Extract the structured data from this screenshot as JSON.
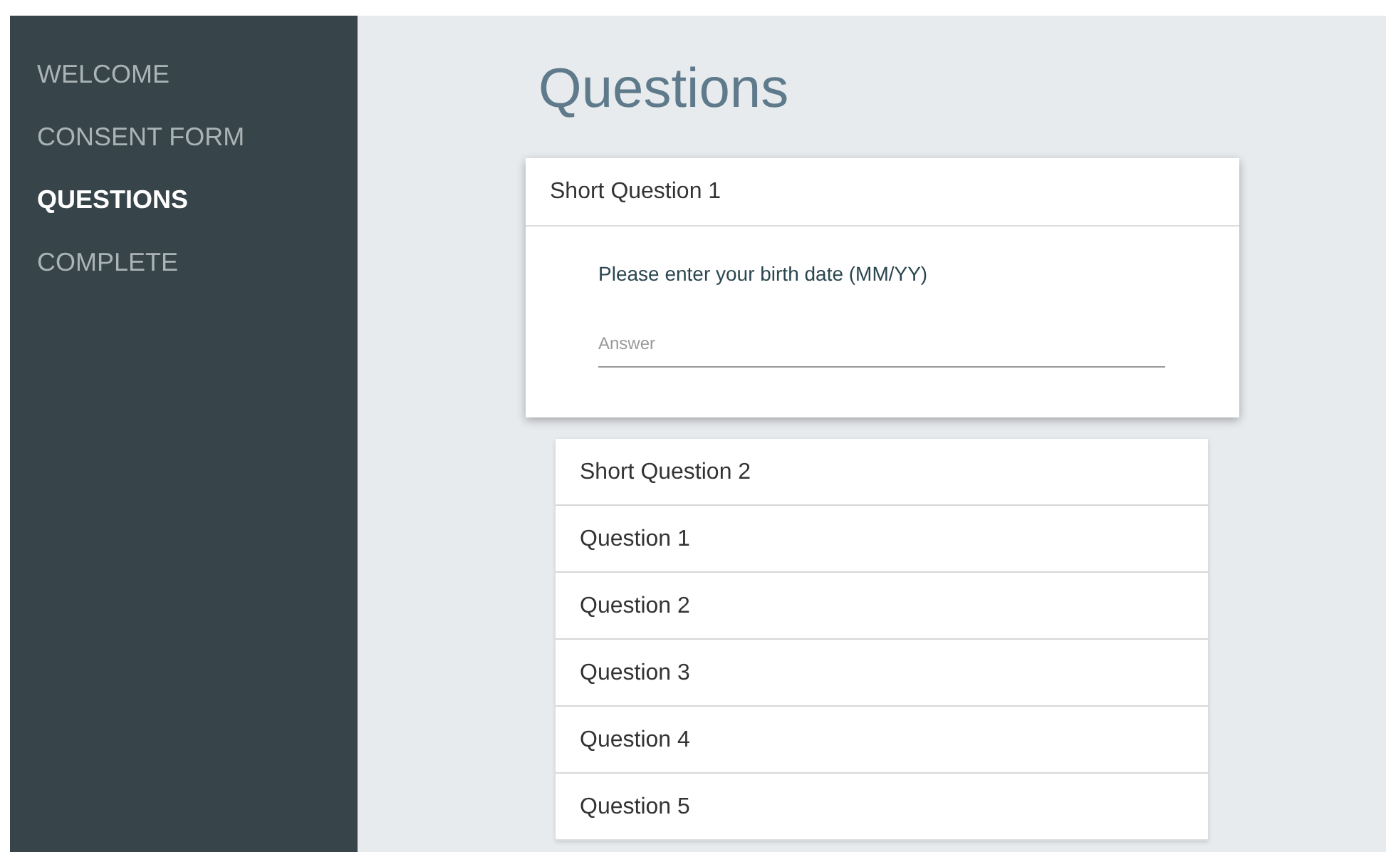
{
  "sidebar": {
    "items": [
      {
        "label": "WELCOME",
        "selected": false
      },
      {
        "label": "CONSENT FORM",
        "selected": false
      },
      {
        "label": "QUESTIONS",
        "selected": true
      },
      {
        "label": "COMPLETE",
        "selected": false
      }
    ]
  },
  "page_title": "Questions",
  "questions": [
    {
      "title": "Short Question 1",
      "expanded": true,
      "prompt": "Please enter your birth date (MM/YY)",
      "answer": {
        "placeholder": "Answer"
      }
    },
    {
      "title": "Short Question 2",
      "expanded": false
    },
    {
      "title": "Question 1",
      "expanded": false
    },
    {
      "title": "Question 2",
      "expanded": false
    },
    {
      "title": "Question 3",
      "expanded": false
    },
    {
      "title": "Question 4",
      "expanded": false
    },
    {
      "title": "Question 5",
      "expanded": false
    }
  ]
}
